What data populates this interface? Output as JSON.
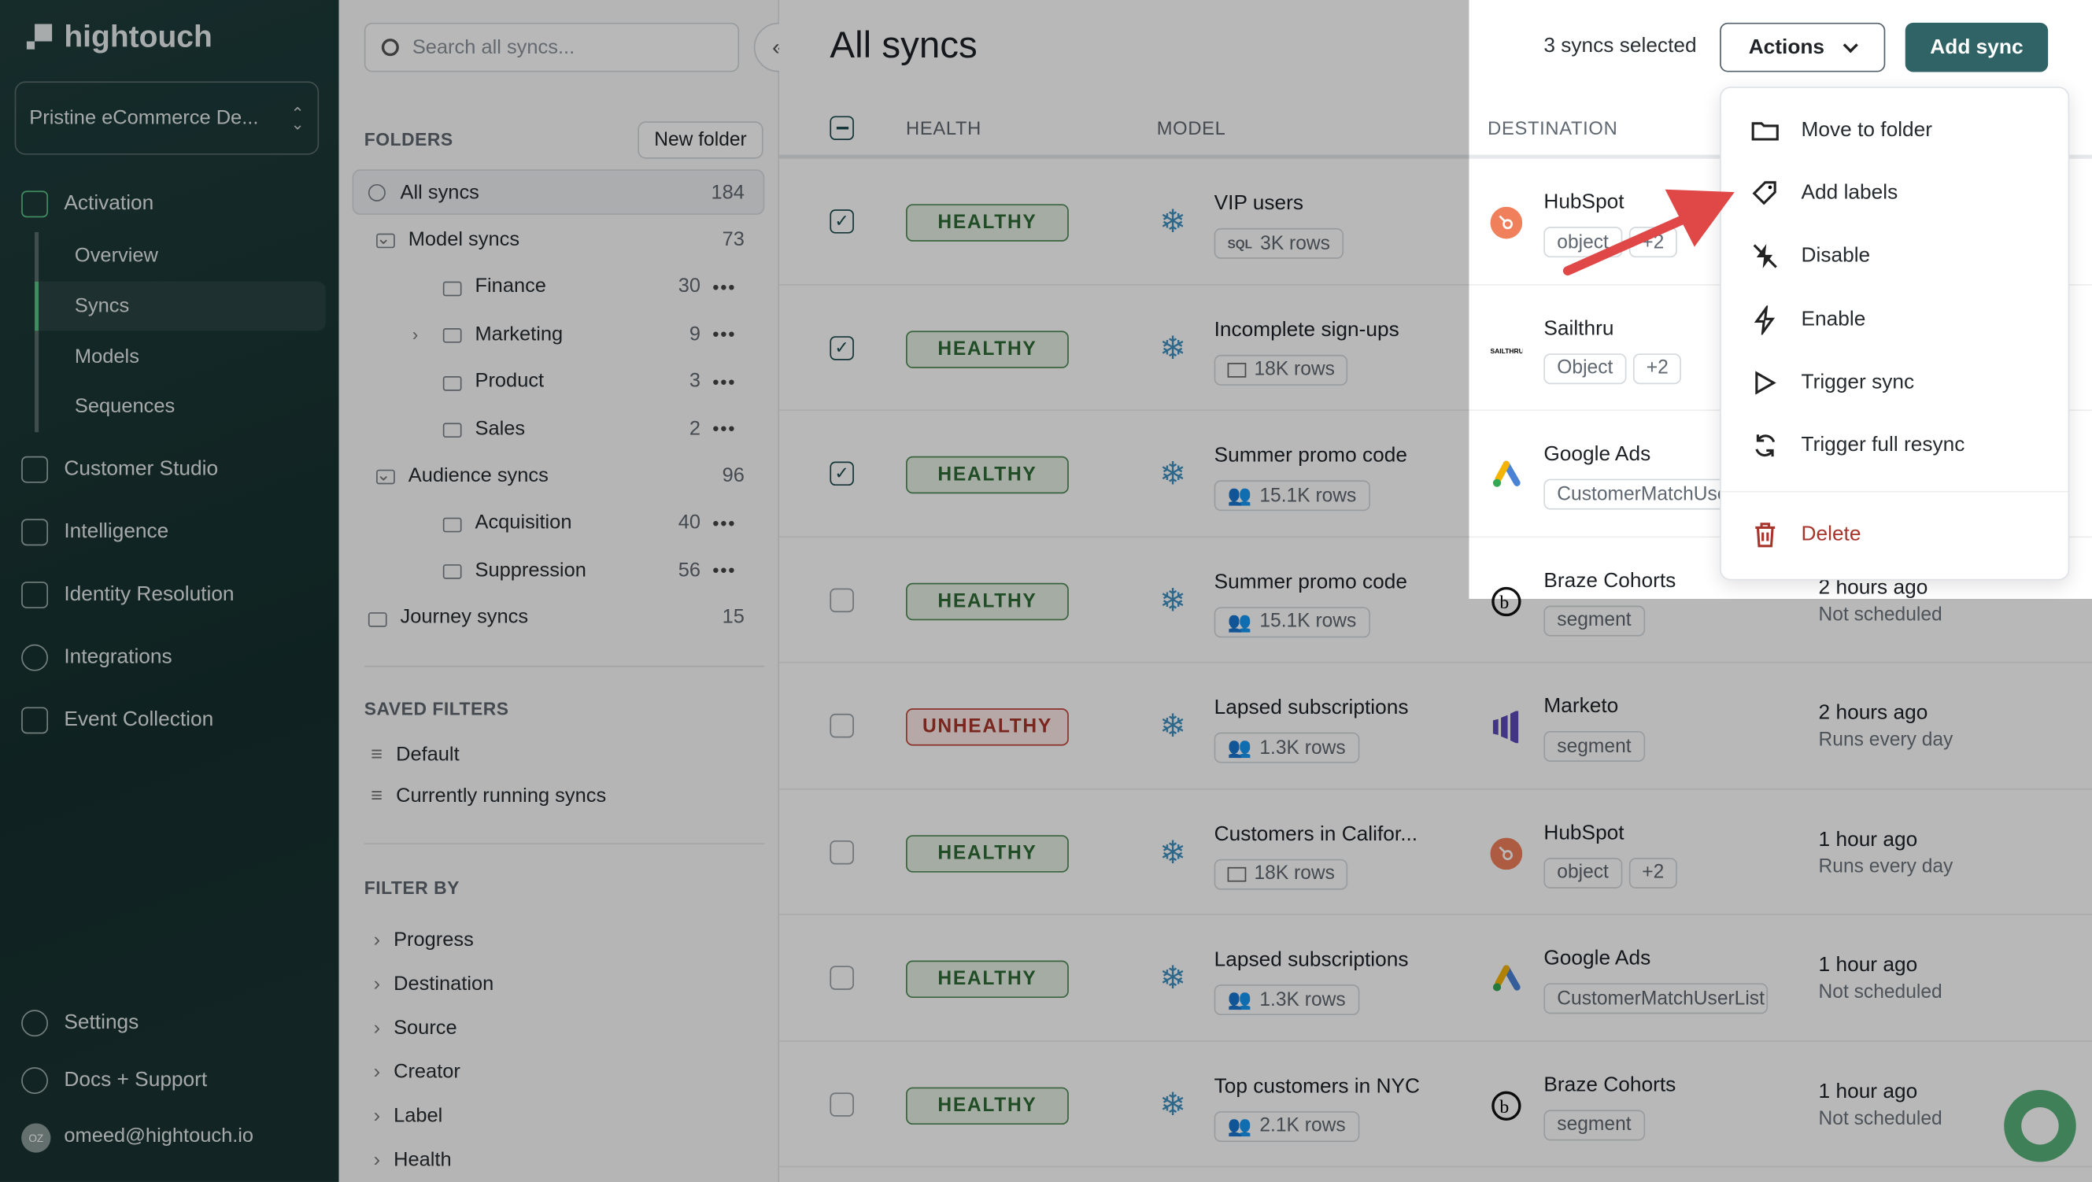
{
  "app": {
    "logo": "hightouch",
    "workspace": "Pristine eCommerce De...",
    "user_initials": "OZ",
    "user_email": "omeed@hightouch.io"
  },
  "sidebar": {
    "activation": "Activation",
    "sub": [
      "Overview",
      "Syncs",
      "Models",
      "Sequences"
    ],
    "items": [
      "Customer Studio",
      "Intelligence",
      "Identity Resolution",
      "Integrations",
      "Event Collection"
    ],
    "settings": "Settings",
    "docs": "Docs + Support"
  },
  "folders": {
    "search_placeholder": "Search all syncs...",
    "heading": "FOLDERS",
    "new_folder": "New folder",
    "tree": [
      {
        "label": "All syncs",
        "count": "184",
        "level": 0,
        "icon": "globe"
      },
      {
        "label": "Model syncs",
        "count": "73",
        "level": 0,
        "icon": "model",
        "chevron": "down"
      },
      {
        "label": "Finance",
        "count": "30",
        "level": 1,
        "icon": "folder",
        "dots": true
      },
      {
        "label": "Marketing",
        "count": "9",
        "level": 1,
        "icon": "folder",
        "dots": true,
        "chevron": "right"
      },
      {
        "label": "Product",
        "count": "3",
        "level": 1,
        "icon": "folder",
        "dots": true
      },
      {
        "label": "Sales",
        "count": "2",
        "level": 1,
        "icon": "folder",
        "dots": true
      },
      {
        "label": "Audience syncs",
        "count": "96",
        "level": 0,
        "icon": "audience",
        "chevron": "down"
      },
      {
        "label": "Acquisition",
        "count": "40",
        "level": 1,
        "icon": "folder",
        "dots": true
      },
      {
        "label": "Suppression",
        "count": "56",
        "level": 1,
        "icon": "folder",
        "dots": true
      },
      {
        "label": "Journey syncs",
        "count": "15",
        "level": 0,
        "icon": "journey"
      }
    ],
    "saved_heading": "SAVED FILTERS",
    "saved": [
      "Default",
      "Currently running syncs"
    ],
    "filter_heading": "FILTER BY",
    "filters": [
      "Progress",
      "Destination",
      "Source",
      "Creator",
      "Label",
      "Health"
    ]
  },
  "main": {
    "title": "All syncs",
    "selected_text": "3 syncs selected",
    "actions": "Actions",
    "add_sync": "Add sync",
    "columns": {
      "health": "HEALTH",
      "model": "MODEL",
      "destination": "DESTINATION"
    },
    "rows": [
      {
        "checked": true,
        "health": "HEALTHY",
        "model": "VIP users",
        "model_icon": "sql",
        "rows": "3K rows",
        "dest": "HubSpot",
        "dest_logo": "hubspot",
        "tags": [
          "object",
          "+2"
        ],
        "last": "",
        "sched": ""
      },
      {
        "checked": true,
        "health": "HEALTHY",
        "model": "Incomplete sign-ups",
        "model_icon": "table",
        "rows": "18K rows",
        "dest": "Sailthru",
        "dest_logo": "sailthru",
        "tags": [
          "Object",
          "+2"
        ],
        "last": "",
        "sched": ""
      },
      {
        "checked": true,
        "health": "HEALTHY",
        "model": "Summer promo code",
        "model_icon": "audience",
        "rows": "15.1K rows",
        "dest": "Google Ads",
        "dest_logo": "google-ads",
        "tags": [
          "CustomerMatchUserList"
        ],
        "last": "",
        "sched": ""
      },
      {
        "checked": false,
        "health": "HEALTHY",
        "model": "Summer promo code",
        "model_icon": "audience",
        "rows": "15.1K rows",
        "dest": "Braze Cohorts",
        "dest_logo": "braze",
        "tags": [
          "segment"
        ],
        "last": "2 hours ago",
        "sched": "Not scheduled"
      },
      {
        "checked": false,
        "health": "UNHEALTHY",
        "model": "Lapsed subscriptions",
        "model_icon": "audience",
        "rows": "1.3K rows",
        "dest": "Marketo",
        "dest_logo": "marketo",
        "tags": [
          "segment"
        ],
        "last": "2 hours ago",
        "sched": "Runs every day"
      },
      {
        "checked": false,
        "health": "HEALTHY",
        "model": "Customers in Califor...",
        "model_icon": "table",
        "rows": "18K rows",
        "dest": "HubSpot",
        "dest_logo": "hubspot",
        "tags": [
          "object",
          "+2"
        ],
        "last": "1 hour ago",
        "sched": "Runs every day"
      },
      {
        "checked": false,
        "health": "HEALTHY",
        "model": "Lapsed subscriptions",
        "model_icon": "audience",
        "rows": "1.3K rows",
        "dest": "Google Ads",
        "dest_logo": "google-ads",
        "tags": [
          "CustomerMatchUserList"
        ],
        "last": "1 hour ago",
        "sched": "Not scheduled"
      },
      {
        "checked": false,
        "health": "HEALTHY",
        "model": "Top customers in NYC",
        "model_icon": "audience",
        "rows": "2.1K rows",
        "dest": "Braze Cohorts",
        "dest_logo": "braze",
        "tags": [
          "segment"
        ],
        "last": "1 hour ago",
        "sched": "Not scheduled"
      }
    ]
  },
  "actions_menu": [
    {
      "label": "Move to folder",
      "icon": "folder"
    },
    {
      "label": "Add labels",
      "icon": "tag"
    },
    {
      "label": "Disable",
      "icon": "bolt-off"
    },
    {
      "label": "Enable",
      "icon": "bolt"
    },
    {
      "label": "Trigger sync",
      "icon": "play"
    },
    {
      "label": "Trigger full resync",
      "icon": "refresh"
    },
    {
      "label": "Delete",
      "icon": "trash"
    }
  ],
  "colors": {
    "brand_dark": "#1d3a38",
    "primary": "#2f6366",
    "healthy": "#4f8a55",
    "unhealthy": "#c0463c",
    "delete": "#a8352b",
    "annotation_arrow": "#e04848"
  }
}
